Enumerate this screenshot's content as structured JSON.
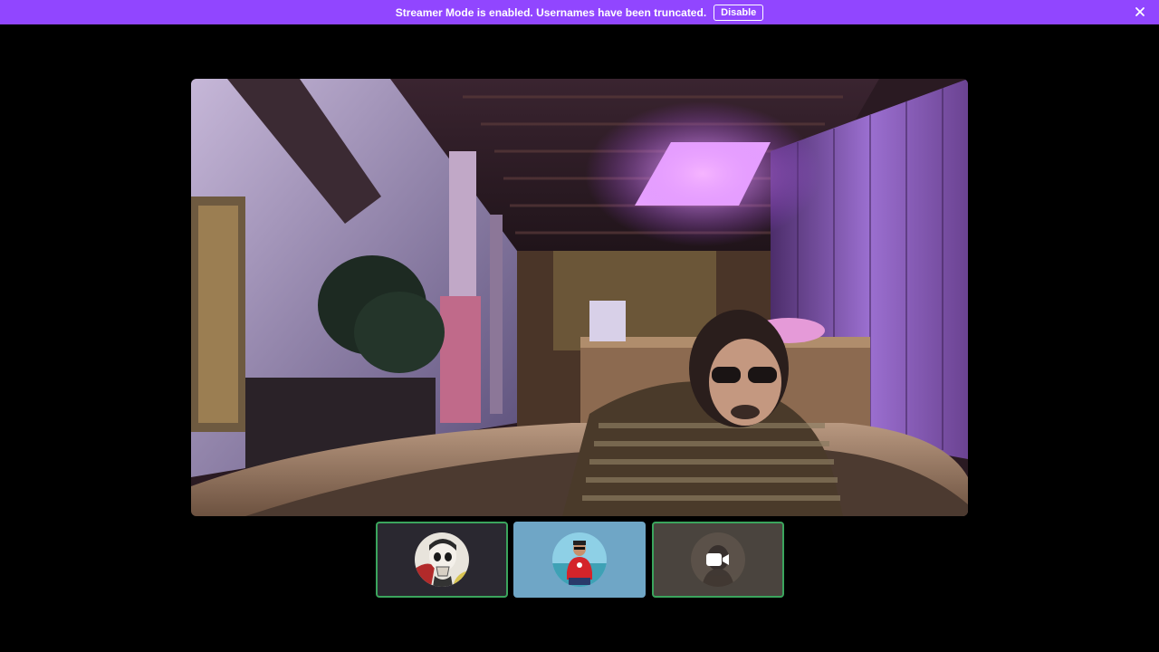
{
  "banner": {
    "message": "Streamer Mode is enabled. Usernames have been truncated.",
    "disable_label": "Disable",
    "background_color": "#9146ff",
    "close_icon": "close-icon"
  },
  "stage": {
    "main_video": "participant-camera-feed"
  },
  "participants": [
    {
      "tile": "participant-tile-1",
      "avatar": "skull-avatar",
      "speaking_outline_color": "#3ba55d"
    },
    {
      "tile": "participant-tile-2",
      "avatar": "man-red-shirt-avatar",
      "background_color": "#6fa6c6"
    },
    {
      "tile": "participant-tile-3",
      "avatar": "camera-icon",
      "speaking_outline_color": "#3ba55d"
    }
  ]
}
